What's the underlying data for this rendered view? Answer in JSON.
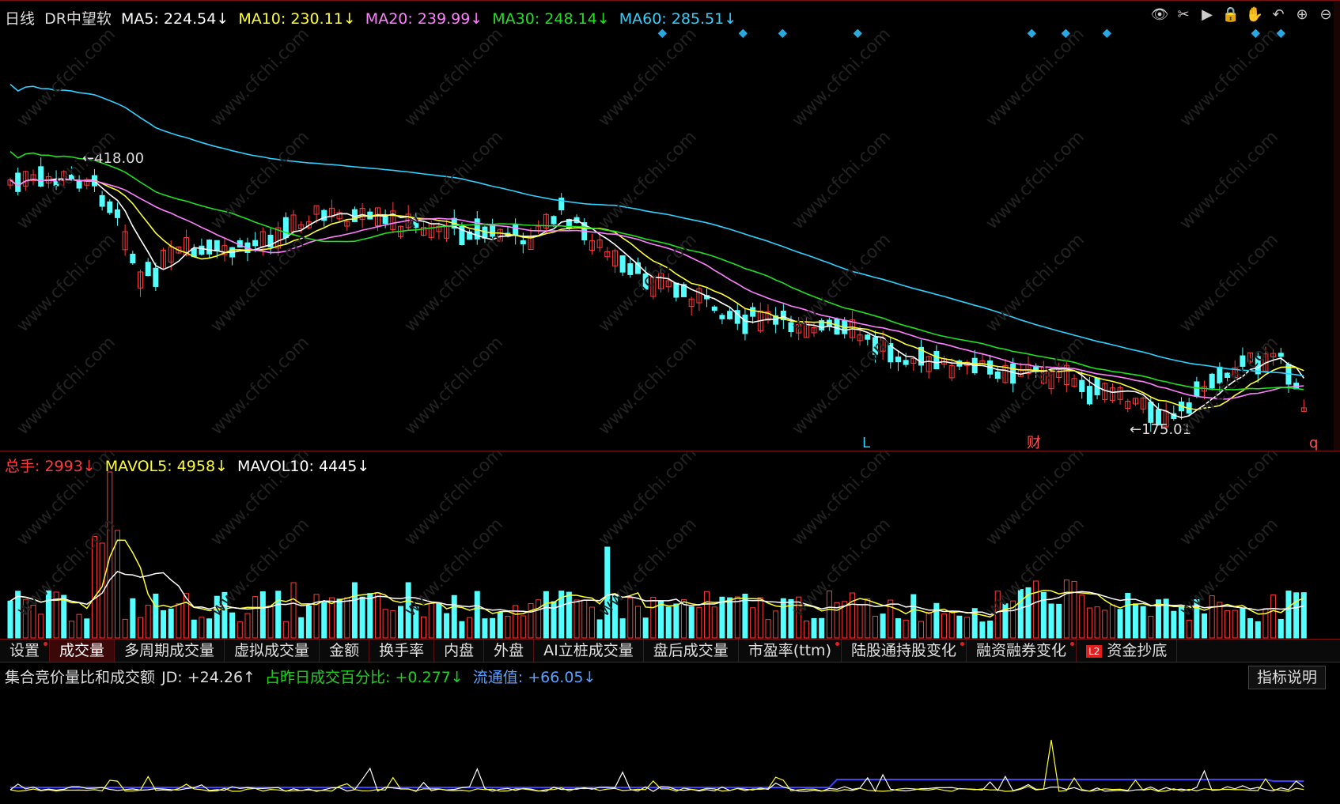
{
  "price_legend": {
    "period": "日线",
    "stock": "DR中望软",
    "ma5": "MA5: 224.54↓",
    "ma10": "MA10: 230.11↓",
    "ma20": "MA20: 239.99↓",
    "ma30": "MA30: 248.14↓",
    "ma60": "MA60: 285.51↓"
  },
  "toolbar_icons": [
    "eye-icon",
    "scissors-icon",
    "play-icon",
    "lock-icon",
    "hand-icon",
    "undo-icon",
    "zoom-in-icon",
    "zoom-out-icon"
  ],
  "price_annotations": {
    "high": "418.00",
    "low": "175.01",
    "mark_l": "L",
    "mark_cai": "财",
    "mark_q": "q"
  },
  "volume_legend": {
    "total": "总手: 2993↓",
    "mavol5": "MAVOL5: 4958↓",
    "mavol10": "MAVOL10: 4445↓"
  },
  "tabs": [
    {
      "label": "设置",
      "dot": true
    },
    {
      "label": "成交量",
      "active": true
    },
    {
      "label": "多周期成交量"
    },
    {
      "label": "虚拟成交量"
    },
    {
      "label": "金额"
    },
    {
      "label": "换手率"
    },
    {
      "label": "内盘"
    },
    {
      "label": "外盘"
    },
    {
      "label": "AI立桩成交量"
    },
    {
      "label": "盘后成交量"
    },
    {
      "label": "市盈率(ttm)",
      "dot": true
    },
    {
      "label": "陆股通持股变化",
      "dot": true
    },
    {
      "label": "融资融券变化",
      "dot": true
    },
    {
      "label": "资金抄底",
      "l2": "L2"
    }
  ],
  "indicator_legend": {
    "name": "集合竞价量比和成交额",
    "jd": "JD: +24.26↑",
    "pct": "占昨日成交百分比: +0.277↓",
    "flow": "流通值: +66.05↓"
  },
  "explain_button": "指标说明",
  "watermark": "www.cfchi.com",
  "colors": {
    "up": "#ff3b3b",
    "down": "#54ffff",
    "ma5": "#ffffff",
    "ma10": "#ffff30",
    "ma20": "#ff80ff",
    "ma30": "#20e020",
    "ma60": "#30d0ff",
    "blue": "#4040ff"
  }
}
